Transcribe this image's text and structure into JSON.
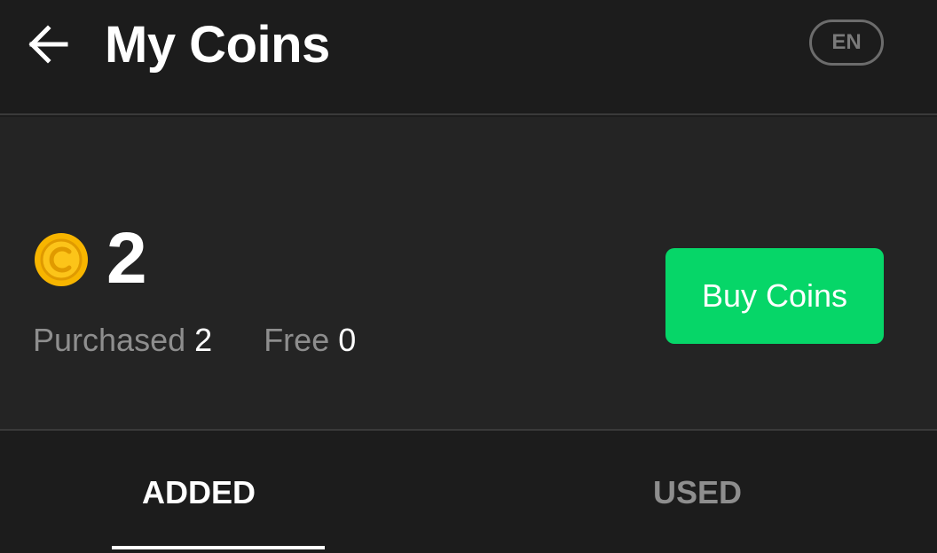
{
  "header": {
    "back_icon": "arrow-left-icon",
    "title": "My Coins",
    "language": "EN"
  },
  "balance": {
    "coin_icon": "coin-icon",
    "total": "2",
    "purchased_label": "Purchased",
    "purchased_value": "2",
    "free_label": "Free",
    "free_value": "0",
    "buy_label": "Buy Coins"
  },
  "tabs": [
    {
      "label": "ADDED",
      "active": true
    },
    {
      "label": "USED",
      "active": false
    }
  ],
  "colors": {
    "background": "#1c1c1c",
    "panel": "#242424",
    "accent": "#06d668",
    "coin": "#f7b500",
    "muted_text": "#8e8e8e"
  }
}
